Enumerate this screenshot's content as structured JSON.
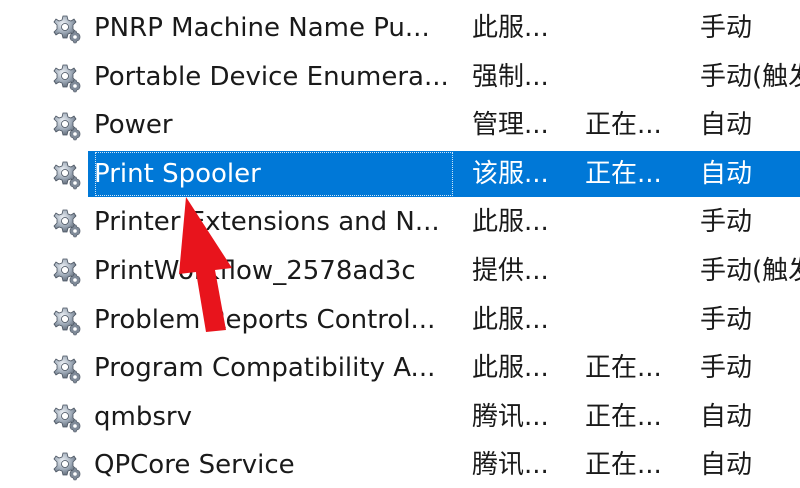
{
  "services": [
    {
      "name": "PNRP Machine Name Pu...",
      "description": "此服...",
      "status": "",
      "startup": "手动",
      "icon": "gear-icon"
    },
    {
      "name": "Portable Device Enumera...",
      "description": "强制...",
      "status": "",
      "startup": "手动(触发",
      "icon": "gear-icon"
    },
    {
      "name": "Power",
      "description": "管理...",
      "status": "正在...",
      "startup": "自动",
      "icon": "gear-icon"
    },
    {
      "name": "Print Spooler",
      "description": "该服...",
      "status": "正在...",
      "startup": "自动",
      "icon": "gear-icon",
      "selected": true
    },
    {
      "name": "Printer Extensions and N...",
      "description": "此服...",
      "status": "",
      "startup": "手动",
      "icon": "gear-icon"
    },
    {
      "name": "PrintWorkflow_2578ad3c",
      "description": "提供...",
      "status": "",
      "startup": "手动(触发",
      "icon": "gear-icon"
    },
    {
      "name": "Problem Reports Control...",
      "description": "此服...",
      "status": "",
      "startup": "手动",
      "icon": "gear-icon"
    },
    {
      "name": "Program Compatibility A...",
      "description": "此服...",
      "status": "正在...",
      "startup": "手动",
      "icon": "gear-icon"
    },
    {
      "name": "qmbsrv",
      "description": "腾讯...",
      "status": "正在...",
      "startup": "自动",
      "icon": "gear-icon"
    },
    {
      "name": "QPCore Service",
      "description": "腾讯...",
      "status": "正在...",
      "startup": "自动",
      "icon": "gear-icon"
    }
  ],
  "colors": {
    "selection": "#0078d7",
    "annotation_arrow": "#e8141c"
  }
}
